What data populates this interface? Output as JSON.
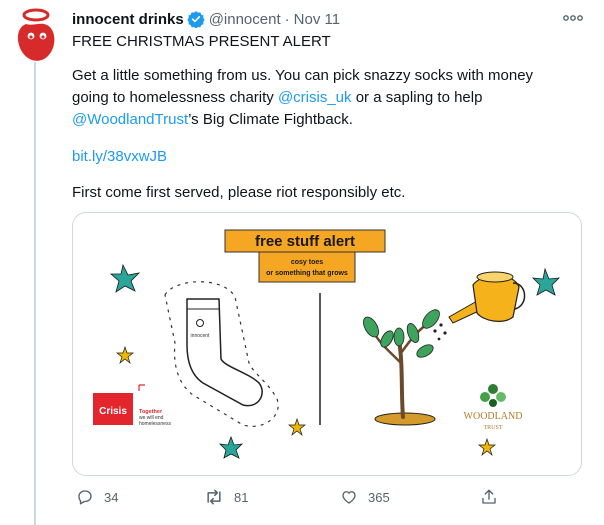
{
  "tweet": {
    "author_name": "innocent drinks",
    "handle": "@innocent",
    "separator": "·",
    "date": "Nov 11",
    "line1": "FREE CHRISTMAS PRESENT ALERT",
    "para_a": "Get a little something from us. You can pick snazzy socks with money",
    "para_b1": "going to homelessness charity ",
    "mention1": "@crisis_uk",
    "para_b2": " or a sapling to help",
    "mention2": "@WoodlandTrust",
    "para_c": "’s Big Climate Fightback.",
    "url": "bit.ly/38vxwJB",
    "closing": "First come first served, please riot responsibly etc."
  },
  "card": {
    "banner_title": "free stuff alert",
    "banner_line1": "cosy toes",
    "banner_line2": "or something that grows",
    "crisis_logo_text": "Crisis",
    "crisis_tag1": "Together",
    "crisis_tag2": "we will end",
    "crisis_tag3": "homelessness",
    "woodland_text1": "WOODLAND",
    "woodland_text2": "TRUST",
    "sock_brand": "innocent"
  },
  "actions": {
    "replies": "34",
    "retweets": "81",
    "likes": "365"
  },
  "colors": {
    "link": "#1d9bf0",
    "verified": "#1d9bf0",
    "banner": "#f5a623",
    "star": "#2aa59a",
    "accent_star": "#f2b705",
    "crisis_red": "#e3262d",
    "woodland_green": "#2e7d32",
    "can_yellow": "#f6b21b",
    "muted": "#536471"
  },
  "icons": [
    "innocent-logo-icon",
    "verified-badge-icon",
    "more-options-icon",
    "reply-icon",
    "retweet-icon",
    "like-icon",
    "share-icon"
  ]
}
